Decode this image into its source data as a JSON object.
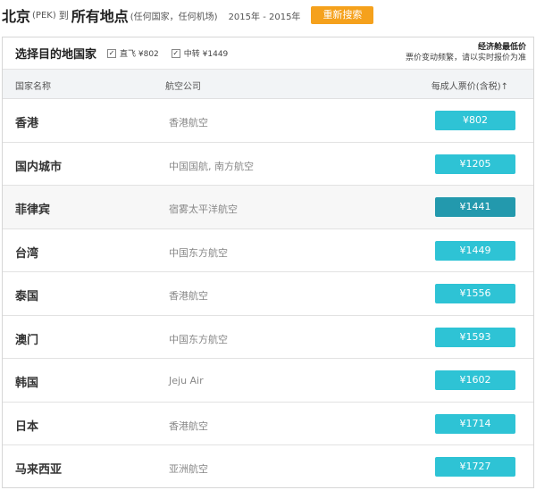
{
  "header": {
    "origin_city": "北京",
    "origin_code": "(PEK)",
    "to_word": "到",
    "destination": "所有地点",
    "destination_note": "(任何国家，任何机场)",
    "years": "2015年 - 2015年",
    "search_button": "重新搜索"
  },
  "filter": {
    "title": "选择目的地国家",
    "direct_label": "直飞 ¥802",
    "transfer_label": "中转 ¥1449",
    "notice_title": "经济舱最低价",
    "notice_sub": "票价变动频繁，请以实时报价为准"
  },
  "table": {
    "columns": {
      "country": "国家名称",
      "airline": "航空公司",
      "price": "每成人票价(含税)↑"
    },
    "rows": [
      {
        "country": "香港",
        "airline": "香港航空",
        "price": "¥802"
      },
      {
        "country": "国内城市",
        "airline": "中国国航, 南方航空",
        "price": "¥1205"
      },
      {
        "country": "菲律宾",
        "airline": "宿雾太平洋航空",
        "price": "¥1441"
      },
      {
        "country": "台湾",
        "airline": "中国东方航空",
        "price": "¥1449"
      },
      {
        "country": "泰国",
        "airline": "香港航空",
        "price": "¥1556"
      },
      {
        "country": "澳门",
        "airline": "中国东方航空",
        "price": "¥1593"
      },
      {
        "country": "韩国",
        "airline": "Jeju Air",
        "price": "¥1602"
      },
      {
        "country": "日本",
        "airline": "香港航空",
        "price": "¥1714"
      },
      {
        "country": "马来西亚",
        "airline": "亚洲航空",
        "price": "¥1727"
      }
    ]
  },
  "colors": {
    "accent_orange": "#f5a11c",
    "price_button": "#2ec3d5",
    "price_button_hover": "#2399ad"
  }
}
